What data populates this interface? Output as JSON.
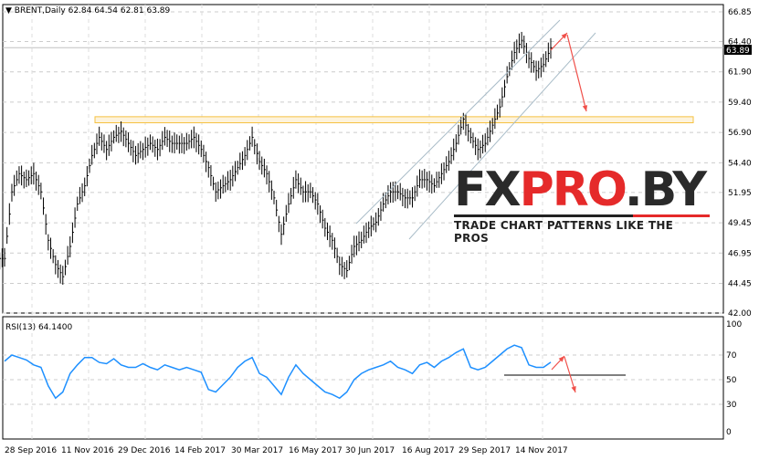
{
  "header": {
    "symbol": "BRENT,Daily",
    "ohlc": "62.84 64.54 62.81 63.89"
  },
  "price_label": "63.89",
  "rsi_label": "RSI(13) 64.1400",
  "logo": {
    "part1": "FX",
    "part2": "PRO",
    "part3": ".BY",
    "tagline": "TRADE CHART PATTERNS LIKE THE PROS"
  },
  "colors": {
    "bars": "#000000",
    "rsi": "#1e90ff",
    "zone": "#f5c242",
    "channel": "#a9bcc8",
    "arrow": "#f0504a"
  },
  "chart_data": [
    {
      "type": "line",
      "title": "BRENT,Daily",
      "ylim": [
        42.0,
        66.85
      ],
      "yticks": [
        "66.85",
        "64.40",
        "61.90",
        "59.40",
        "56.90",
        "54.40",
        "51.95",
        "49.45",
        "46.95",
        "44.45",
        "42.00"
      ],
      "xticks": [
        "28 Sep 2016",
        "11 Nov 2016",
        "29 Dec 2016",
        "14 Feb 2017",
        "30 Mar 2017",
        "16 May 2017",
        "30 Jun 2017",
        "16 Aug 2017",
        "29 Sep 2017",
        "14 Nov 2017"
      ],
      "approx_close": [
        46.5,
        52,
        53.5,
        53,
        53.5,
        52,
        48,
        46,
        45,
        47.5,
        51,
        52.5,
        55,
        56.5,
        55.5,
        56.5,
        57,
        56,
        55,
        55.5,
        56,
        55.5,
        56.5,
        56,
        56,
        56,
        56.5,
        55.5,
        54,
        52,
        52.5,
        53,
        54,
        55,
        56.5,
        54.5,
        53.5,
        51.5,
        48.5,
        51,
        53,
        52,
        52,
        51,
        49,
        48,
        46,
        45.5,
        47.5,
        48,
        49,
        49.5,
        51,
        52,
        52,
        51.5,
        51.5,
        53,
        53,
        52.5,
        53.5,
        54.5,
        56,
        58,
        56.5,
        55.5,
        56,
        57.5,
        59,
        61.5,
        63.5,
        64.5,
        63,
        62,
        62.5,
        63.89
      ],
      "resistance_zone": [
        57.7,
        58.2
      ]
    },
    {
      "type": "line",
      "title": "RSI(13)",
      "value": 64.14,
      "ylim": [
        0,
        100
      ],
      "yticks": [
        "100",
        "70",
        "50",
        "30",
        "0"
      ],
      "approx_values": [
        65,
        70,
        68,
        66,
        62,
        60,
        45,
        35,
        40,
        55,
        62,
        68,
        68,
        64,
        63,
        67,
        62,
        60,
        60,
        63,
        60,
        58,
        62,
        60,
        58,
        60,
        58,
        56,
        42,
        40,
        46,
        52,
        60,
        65,
        68,
        55,
        52,
        45,
        38,
        52,
        62,
        55,
        50,
        45,
        40,
        38,
        35,
        40,
        50,
        55,
        58,
        60,
        62,
        65,
        60,
        58,
        55,
        62,
        64,
        60,
        65,
        68,
        72,
        75,
        60,
        58,
        60,
        65,
        70,
        75,
        78,
        76,
        62,
        60,
        60,
        64.14
      ]
    }
  ]
}
